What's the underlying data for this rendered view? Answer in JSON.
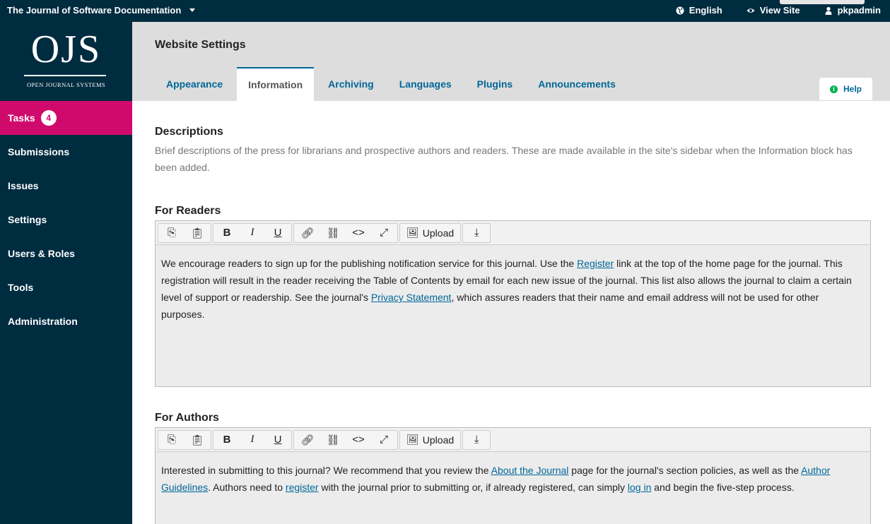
{
  "topbar": {
    "journal_name": "The Journal of Software Documentation",
    "language": "English",
    "view_site": "View Site",
    "user": "pkpadmin"
  },
  "logo": {
    "text": "OJS",
    "subtitle": "OPEN JOURNAL SYSTEMS"
  },
  "sidebar": {
    "items": [
      {
        "label": "Tasks",
        "badge": "4"
      },
      {
        "label": "Submissions"
      },
      {
        "label": "Issues"
      },
      {
        "label": "Settings"
      },
      {
        "label": "Users & Roles"
      },
      {
        "label": "Tools"
      },
      {
        "label": "Administration"
      }
    ]
  },
  "header": {
    "title": "Website Settings",
    "tabs": [
      "Appearance",
      "Information",
      "Archiving",
      "Languages",
      "Plugins",
      "Announcements"
    ],
    "active_tab": "Information",
    "help": "Help"
  },
  "descriptions": {
    "title": "Descriptions",
    "text": "Brief descriptions of the press for librarians and prospective authors and readers. These are made available in the site's sidebar when the Information block has been added."
  },
  "toolbar": {
    "upload_label": "Upload"
  },
  "for_readers": {
    "label": "For Readers",
    "text_1": "We encourage readers to sign up for the publishing notification service for this journal. Use the ",
    "link_register": "Register",
    "text_2": " link at the top of the home page for the journal. This registration will result in the reader receiving the Table of Contents by email for each new issue of the journal. This list also allows the journal to claim a certain level of support or readership. See the journal's ",
    "link_privacy": "Privacy Statement",
    "text_3": ", which assures readers that their name and email address will not be used for other purposes."
  },
  "for_authors": {
    "label": "For Authors",
    "text_1": "Interested in submitting to this journal? We recommend that you review the ",
    "link_about": "About the Journal",
    "text_2": " page for the journal's section policies, as well as the ",
    "link_guidelines": "Author Guidelines",
    "text_3": ". Authors need to ",
    "link_register": "register",
    "text_4": " with the journal prior to submitting or, if already registered, can simply ",
    "link_login": "log in",
    "text_5": " and begin the five-step process."
  },
  "colors": {
    "primary_dark": "#002c40",
    "accent_pink": "#d00a6c",
    "link_blue": "#006798",
    "help_green": "#00b24e"
  }
}
